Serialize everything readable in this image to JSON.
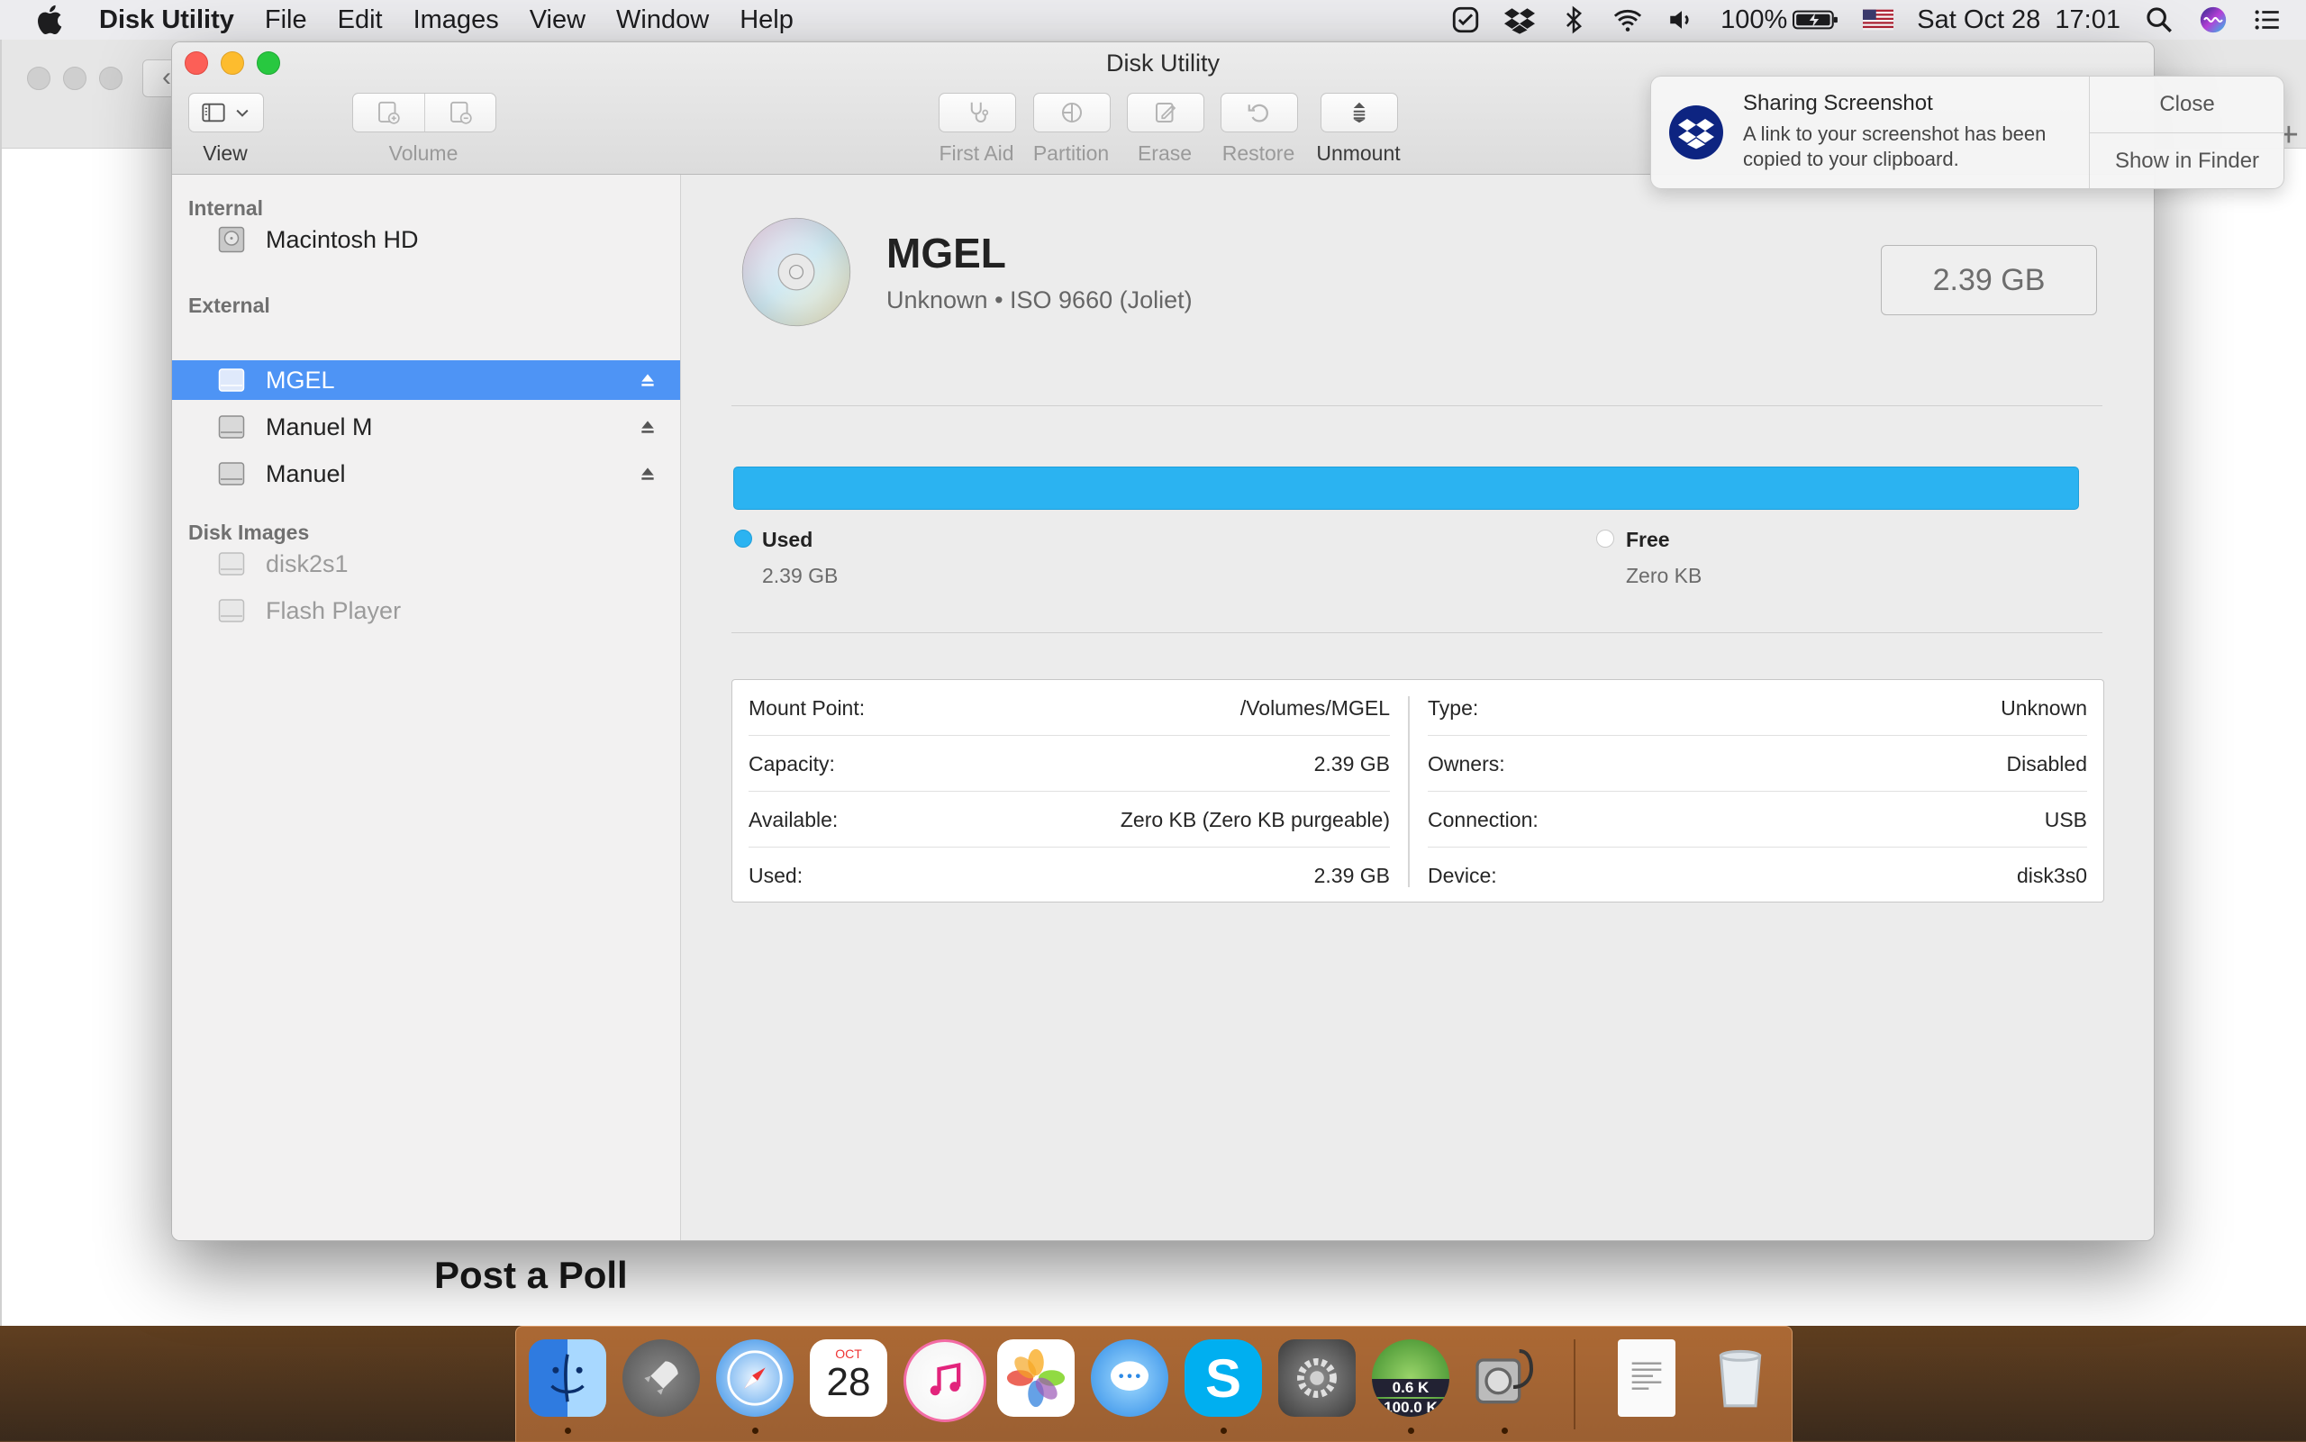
{
  "menubar": {
    "app_name": "Disk Utility",
    "items": [
      "File",
      "Edit",
      "Images",
      "View",
      "Window",
      "Help"
    ],
    "battery": "100%",
    "datetime": "Sat Oct 28  17:01"
  },
  "background_page": {
    "heading": "Post a Poll"
  },
  "window": {
    "title": "Disk Utility",
    "toolbar": {
      "view_label": "View",
      "volume_label": "Volume",
      "first_aid_label": "First Aid",
      "partition_label": "Partition",
      "erase_label": "Erase",
      "restore_label": "Restore",
      "unmount_label": "Unmount"
    }
  },
  "sidebar": {
    "internal_header": "Internal",
    "external_header": "External",
    "images_header": "Disk Images",
    "internal": [
      {
        "label": "Macintosh HD"
      }
    ],
    "external": [
      {
        "label": "MGEL"
      },
      {
        "label": "Manuel M"
      },
      {
        "label": "Manuel"
      }
    ],
    "images": [
      {
        "label": "disk2s1"
      },
      {
        "label": "Flash Player"
      }
    ]
  },
  "volume": {
    "name": "MGEL",
    "subtitle": "Unknown • ISO 9660 (Joliet)",
    "size": "2.39 GB",
    "used_fraction": 1.0,
    "used_label": "Used",
    "used_value": "2.39 GB",
    "free_label": "Free",
    "free_value": "Zero KB"
  },
  "info": {
    "left": [
      {
        "key": "Mount Point:",
        "value": "/Volumes/MGEL"
      },
      {
        "key": "Capacity:",
        "value": "2.39 GB"
      },
      {
        "key": "Available:",
        "value": "Zero KB (Zero KB purgeable)"
      },
      {
        "key": "Used:",
        "value": "2.39 GB"
      }
    ],
    "right": [
      {
        "key": "Type:",
        "value": "Unknown"
      },
      {
        "key": "Owners:",
        "value": "Disabled"
      },
      {
        "key": "Connection:",
        "value": "USB"
      },
      {
        "key": "Device:",
        "value": "disk3s0"
      }
    ]
  },
  "notification": {
    "title": "Sharing Screenshot",
    "body": "A link to your screenshot has been copied to your clipboard.",
    "close_label": "Close",
    "show_label": "Show in Finder"
  },
  "dock": {
    "calendar_month": "OCT",
    "calendar_day": "28",
    "netmon_up": "0.6 K",
    "netmon_down": "100.0 K"
  },
  "colors": {
    "selection": "#4e94f5",
    "usage_bar": "#2bb3f1"
  }
}
